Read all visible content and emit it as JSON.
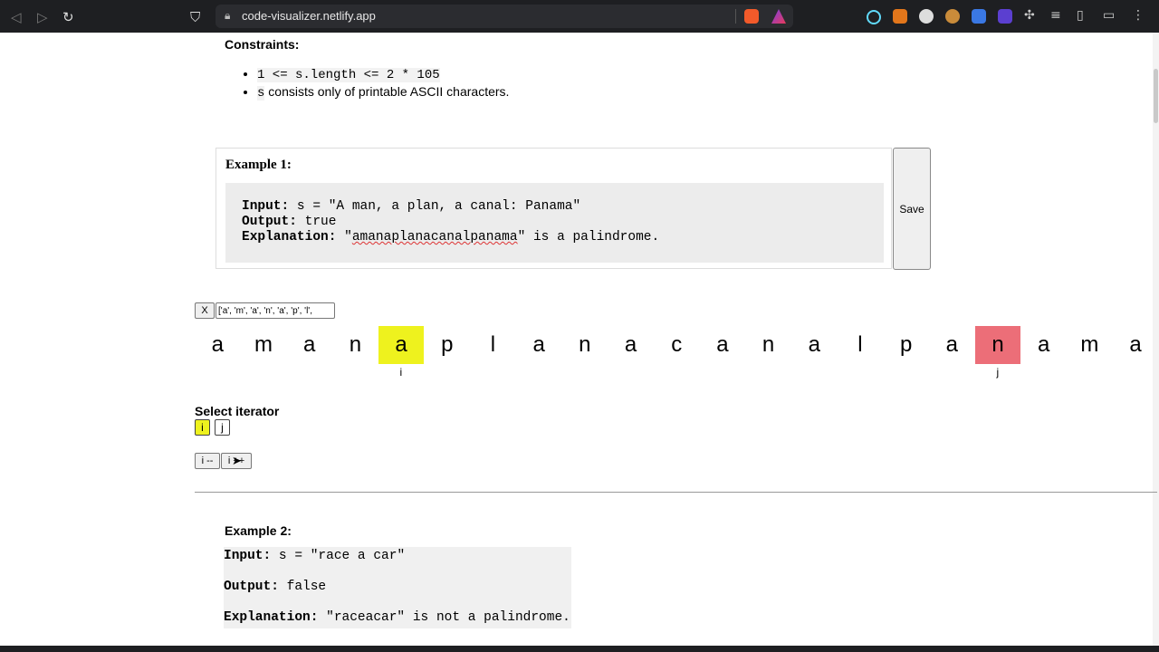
{
  "browser": {
    "url": "code-visualizer.netlify.app"
  },
  "constraints": {
    "title": "Constraints:",
    "items": [
      {
        "code": "1 <= s.length <= 2 * 105",
        "text": ""
      },
      {
        "code": "s",
        "text": " consists only of printable ASCII characters."
      }
    ]
  },
  "example1": {
    "title": "Example 1:",
    "input_label": "Input:",
    "input_value": " s = \"A man, a plan, a canal: Panama\"",
    "output_label": "Output:",
    "output_value": " true",
    "explanation_label": "Explanation:",
    "explanation_quote_open": " \"",
    "explanation_word": "amanaplanacanalpanama",
    "explanation_rest": "\" is a palindrome.",
    "save_label": "Save"
  },
  "visualizer": {
    "close_label": "X",
    "array_value": "['a', 'm', 'a', 'n', 'a', 'p', 'l',",
    "chars": [
      "a",
      "m",
      "a",
      "n",
      "a",
      "p",
      "l",
      "a",
      "n",
      "a",
      "c",
      "a",
      "n",
      "a",
      "l",
      "p",
      "a",
      "n",
      "a",
      "m",
      "a"
    ],
    "i_index": 4,
    "j_index": 17,
    "i_label": "i",
    "j_label": "j",
    "highlight_i_color": "#eef21e",
    "highlight_j_color": "#ec6e78"
  },
  "iterator": {
    "label": "Select iterator",
    "options": [
      "i",
      "j"
    ],
    "selected": "i",
    "decrement_label": "i --",
    "increment_label": "i ++"
  },
  "example2": {
    "title": "Example 2:",
    "input_label": "Input:",
    "input_value": " s = \"race a car\"",
    "output_label": "Output:",
    "output_value": " false",
    "explanation_label": "Explanation:",
    "explanation_value": " \"raceacar\" is not a palindrome."
  }
}
